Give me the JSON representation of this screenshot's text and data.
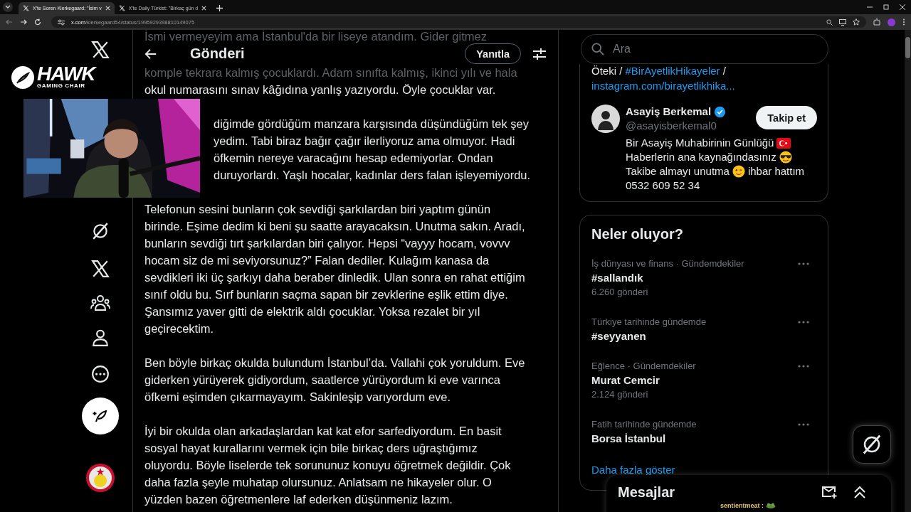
{
  "browser": {
    "tabs": [
      {
        "title": "X'te Soren Kierkegaard: \"İsim v",
        "selected": true
      },
      {
        "title": "X'te Daily Türkist: \"Birkaç gün d",
        "selected": false
      }
    ],
    "url_host": "x.com",
    "url_path": "/kierkegaard54/status/1995929398810149075"
  },
  "overlay": {
    "logo_title": "HAWK",
    "logo_subtitle": "GAMING CHAIR",
    "chat_user": "sentientmeat :"
  },
  "header": {
    "title": "Gönderi",
    "reply_button": "Yanıtla"
  },
  "post": {
    "paragraphs": [
      {
        "kind": "faded_top",
        "lines": [
          "İsmi vermeyeyim ama İstanbul'da bir liseye atandım. Gider gitmez"
        ]
      },
      {
        "kind": "faded",
        "lines": [
          "komple tekrara kalmış çocuklardı. Adam sınıfta kalmış, ikinci yılı ve hala"
        ]
      },
      {
        "kind": "continued",
        "lines": [
          "okul numarasını sınav kâğıdına yanlış yazıyordu. Öyle çocuklar var."
        ]
      },
      {
        "kind": "covered",
        "lines": [
          "diğimde gördüğüm manzara karşısında düşündüğüm tek şey",
          "yedim. Tabi biraz bağır çağır ilerliyoruz ama olmuyor. Hadi",
          "öfkemin nereye varacağını hesap edemiyorlar. Ondan",
          "duruyorlardı. Yaşlı hocalar, kadınlar ders falan işleyemiyordu."
        ]
      },
      {
        "kind": "normal",
        "lines": [
          "Telefonun sesini bunların çok sevdiği şarkılardan biri yaptım günün",
          "birinde. Eşime dedim ki beni şu saatte arayacaksın. Unutma sakın. Aradı,",
          "bunların sevdiği tırt şarkılardan biri çalıyor. Hepsi “vayyy hocam, vovvv",
          "hocam siz de mi seviyorsunuz?” Falan dediler. Kulağım kanasa da",
          "sevdikleri iki üç şarkıyı daha beraber dinledik. Ulan sonra en rahat ettiğim",
          "sınıf oldu bu. Sırf bunların saçma sapan bir zevklerine eşlik ettim diye.",
          "Şansımız yaver gitti de elektrik aldı çocuklar. Yoksa rezalet bir yıl",
          "geçirecektim."
        ]
      },
      {
        "kind": "normal",
        "lines": [
          "Ben böyle birkaç okulda bulundum İstanbul’da. Vallahi çok yoruldum. Eve",
          "giderken yürüyerek gidiyordum, saatlerce yürüyordum ki eve varınca",
          "öfkemi eşimden çıkarmayayım. Sakinleşip varıyordum eve."
        ]
      },
      {
        "kind": "normal",
        "lines": [
          "İyi bir okulda olan arkadaşlardan kat kat efor sarfediyordum. En basit",
          "sosyal hayat kurallarını vermek için bile birkaç ders uğraştığımız",
          "oluyordu. Böyle liselerde tek sorununuz konuyu öğretmek değildir. Çok",
          "daha fazla şeyle muhatap olursunuz. Anlatsam ne hikayeler olur. O",
          "yüzden bazen öğretmenlere laf ederken düşünmeniz lazım."
        ]
      }
    ]
  },
  "search": {
    "placeholder": "Ara"
  },
  "suggestion_card": {
    "bio_top": {
      "text_before": "Öteki /",
      "hashtag": "#BirAyetlikHikayeler",
      "text_after": "/"
    },
    "link": "instagram.com/birayetlikhika...",
    "account": {
      "name": "Asayiş Berkemal",
      "verified": true,
      "handle": "@asayisberkemal0",
      "follow_button": "Takip et",
      "bio": [
        {
          "text": "Bir Asayiş Muhabirinin Günlüğü",
          "kind": "flag"
        },
        {
          "text": "Haberlerin ana kaynağındasınız",
          "kind": "sunglasses"
        },
        {
          "text": "Takibe almayı unutma",
          "kind": "wink",
          "after": "ihbar hattım"
        },
        {
          "text": "0532 609 52 34",
          "kind": "plain"
        }
      ]
    }
  },
  "trends": {
    "title": "Neler oluyor?",
    "items": [
      {
        "meta": "İş dünyası ve finans · Gündemdekiler",
        "name": "#sallandık",
        "count": "6.260 gönderi"
      },
      {
        "meta": "Türkiye tarihinde gündemde",
        "name": "#seyyanen"
      },
      {
        "meta": "Eğlence · Gündemdekiler",
        "name": "Murat Cemcir",
        "count": "2.124 gönderi"
      },
      {
        "meta": "Fatih tarihinde gündemde",
        "name": "Borsa İstanbul"
      }
    ],
    "more_link": "Daha fazla göster"
  },
  "messages": {
    "title": "Mesajlar"
  }
}
